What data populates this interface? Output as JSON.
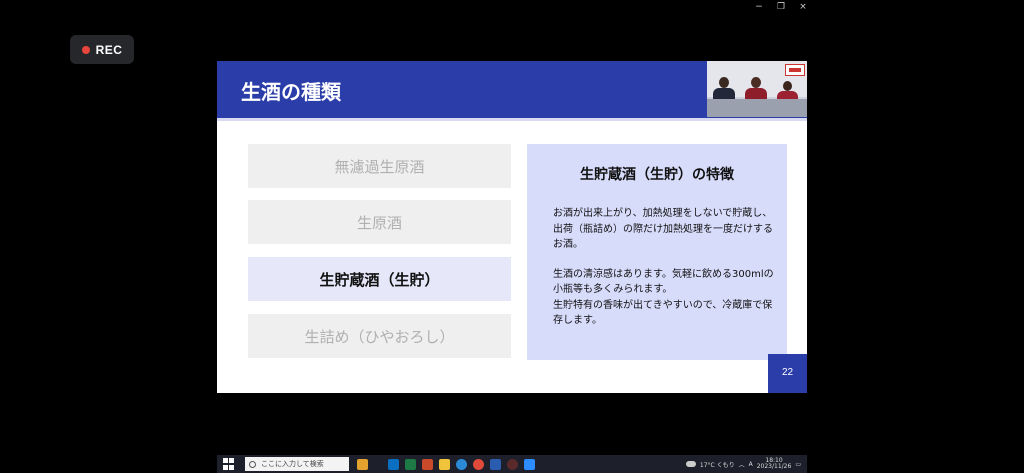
{
  "window": {
    "minimize_label": "−",
    "restore_label": "❐",
    "close_label": "×"
  },
  "recording": {
    "label": "REC",
    "dot_color": "#e8453c"
  },
  "slide": {
    "title": "生酒の種類",
    "header_color": "#2b3da8",
    "options": [
      {
        "label": "無濾過生原酒",
        "active": false
      },
      {
        "label": "生原酒",
        "active": false
      },
      {
        "label": "生貯蔵酒（生貯）",
        "active": true
      },
      {
        "label": "生詰め（ひやおろし）",
        "active": false
      }
    ],
    "panel": {
      "title": "生貯蔵酒（生貯）の特徴",
      "paragraph1": "お酒が出来上がり、加熱処理をしないで貯蔵し、出荷（瓶詰め）の際だけ加熱処理を一度だけするお酒。",
      "paragraph2": "生酒の清涼感はあります。気軽に飲める300mlの小瓶等も多くみられます。",
      "paragraph3": "生貯特有の香味が出てきやすいので、冷蔵庫で保存します。"
    },
    "page_number": "22"
  },
  "taskbar": {
    "search_placeholder": "ここに入力して検索",
    "weather": "17°C くもり",
    "ime": "A",
    "time": "18:10",
    "date": "2023/11/26"
  }
}
